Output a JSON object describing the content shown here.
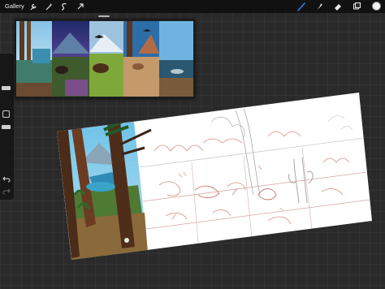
{
  "toolbar": {
    "gallery_label": "Gallery",
    "left_icons": [
      "wrench-icon",
      "magic-wand-icon",
      "selection-icon",
      "transform-arrow-icon"
    ],
    "right_icons": [
      "brush-icon",
      "smudge-icon",
      "eraser-icon",
      "layers-icon",
      "color-swatch"
    ],
    "active_tool": "brush-icon",
    "accent_color": "#2f7df6",
    "current_color": "#f2f2f2"
  },
  "sidebar": {
    "controls": [
      "brush-size-slider",
      "opacity-slider",
      "modify-button",
      "undo-button",
      "redo-button"
    ]
  },
  "reference": {
    "panel_color": "#1b1b1b"
  },
  "canvas": {
    "paper_color": "#ffffff",
    "sketch_color": "#d9877e"
  }
}
